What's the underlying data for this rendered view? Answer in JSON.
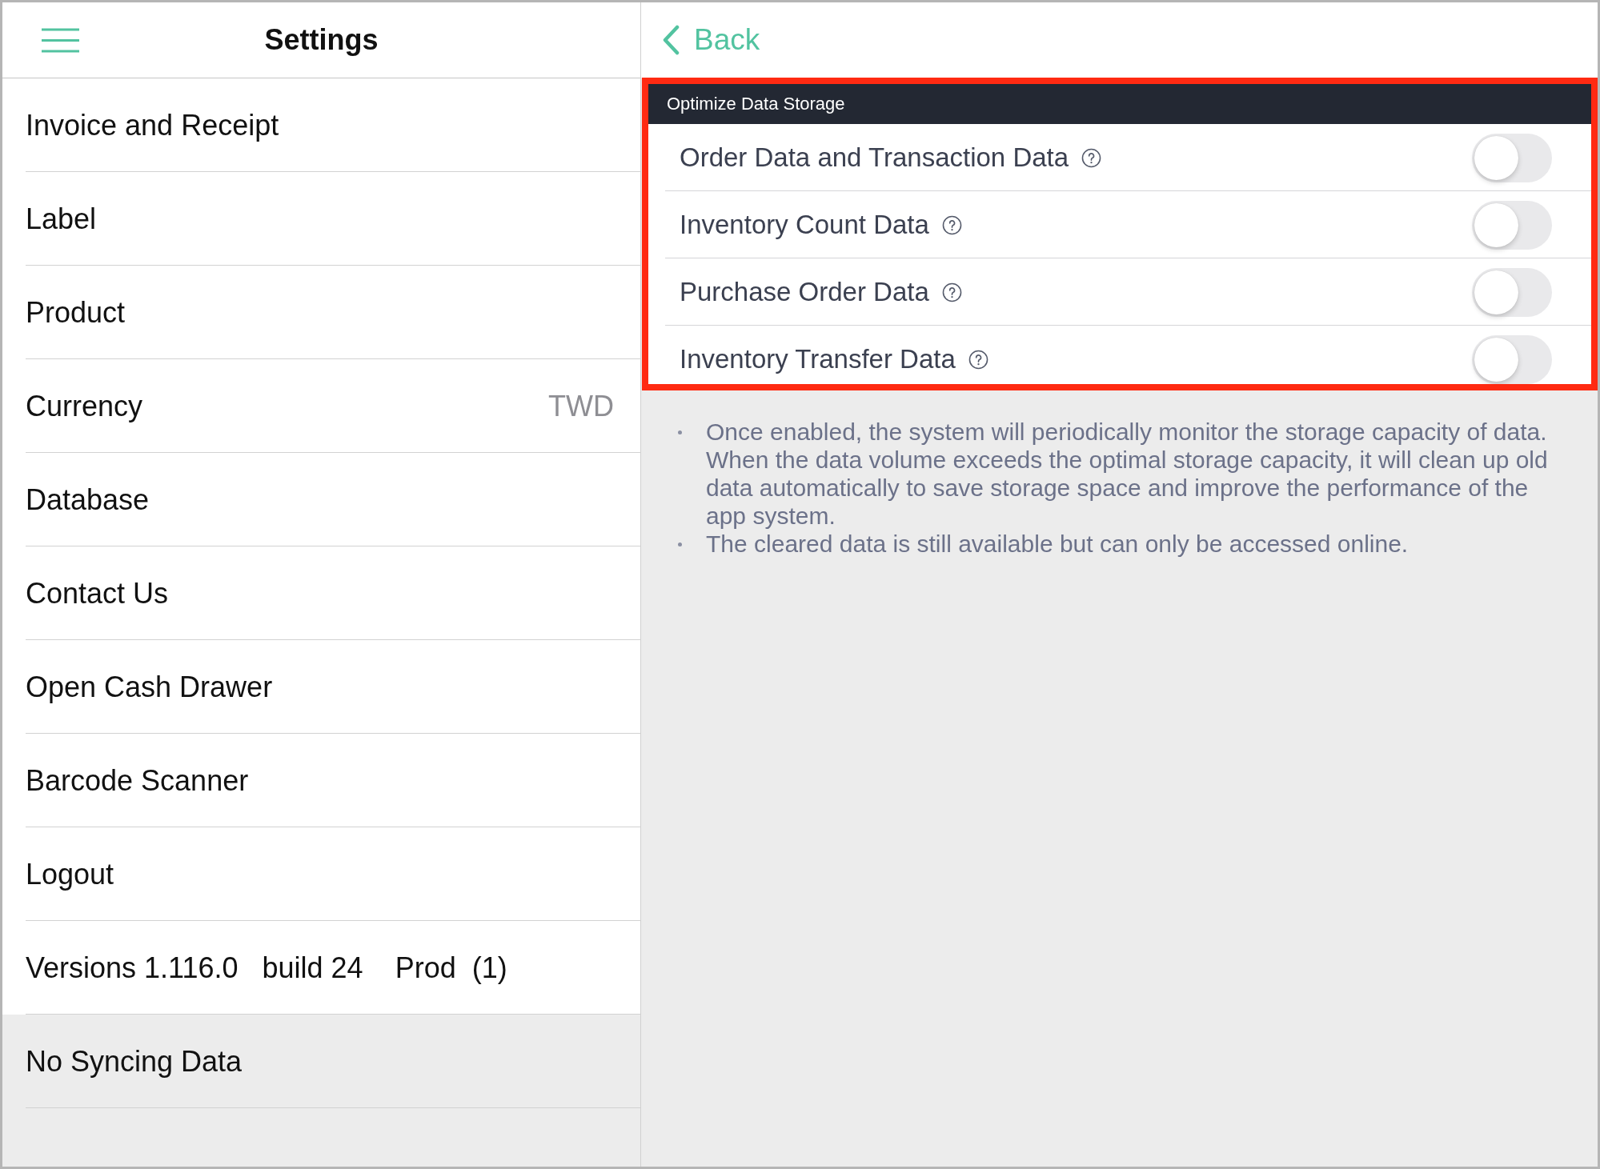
{
  "sidebar": {
    "title": "Settings",
    "items": [
      {
        "label": "Invoice and Receipt",
        "kind": "nav"
      },
      {
        "label": "Label",
        "kind": "nav"
      },
      {
        "label": "Product",
        "kind": "nav"
      },
      {
        "label": "Currency",
        "value": "TWD",
        "kind": "nav"
      },
      {
        "label": "Database",
        "kind": "nav"
      },
      {
        "label": "Contact Us",
        "kind": "nav"
      },
      {
        "label": "Open Cash Drawer",
        "kind": "nav"
      },
      {
        "label": "Barcode Scanner",
        "kind": "nav"
      },
      {
        "label": "Logout",
        "kind": "nav"
      },
      {
        "label": "Versions 1.116.0   build 24    Prod  (1)",
        "kind": "info"
      },
      {
        "label": "No Syncing Data",
        "kind": "status"
      }
    ]
  },
  "detail": {
    "back_label": "Back",
    "section": {
      "title": "Optimize Data Storage",
      "annotated": true,
      "toggles": [
        {
          "label": "Order Data and Transaction Data",
          "on": false
        },
        {
          "label": "Inventory Count Data",
          "on": false
        },
        {
          "label": "Purchase Order Data",
          "on": false
        },
        {
          "label": "Inventory Transfer Data",
          "on": false
        }
      ]
    },
    "notes": [
      "Once enabled, the system will periodically monitor the storage capacity of data. When the data volume exceeds the optimal storage capacity, it will clean up old data automatically to save storage space and improve the performance of the app system.",
      "The cleared data is still available but can only be accessed online."
    ]
  }
}
